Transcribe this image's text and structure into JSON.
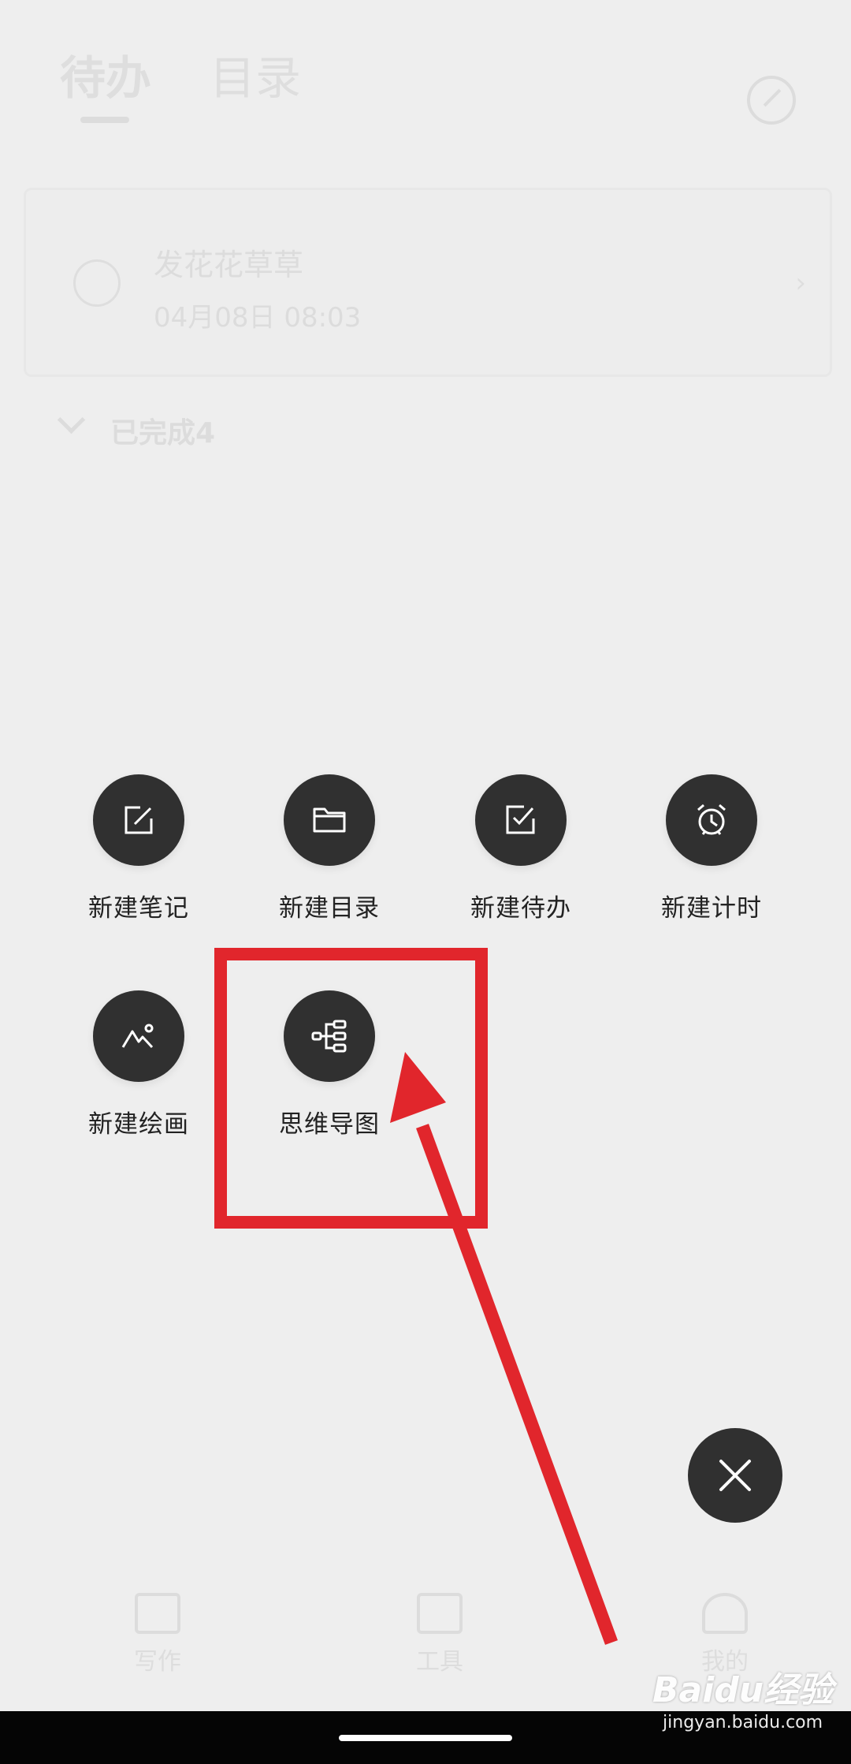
{
  "background_app": {
    "tabs": [
      {
        "label": "待办",
        "active": true
      },
      {
        "label": "目录",
        "active": false
      }
    ],
    "todo_card": {
      "title": "发花花草草",
      "time": "04月08日 08:03"
    },
    "completed_label": "已完成4",
    "bottom_nav": [
      {
        "label": "写作",
        "icon": "home-icon"
      },
      {
        "label": "工具",
        "icon": "toolbox-icon"
      },
      {
        "label": "我的",
        "icon": "person-icon"
      }
    ]
  },
  "create_menu": {
    "items": [
      {
        "label": "新建笔记",
        "icon": "edit-note-icon"
      },
      {
        "label": "新建目录",
        "icon": "folder-icon"
      },
      {
        "label": "新建待办",
        "icon": "checkbox-icon"
      },
      {
        "label": "新建计时",
        "icon": "alarm-clock-icon"
      },
      {
        "label": "新建绘画",
        "icon": "drawing-icon"
      },
      {
        "label": "思维导图",
        "icon": "mind-map-icon"
      }
    ],
    "close_icon": "close-icon"
  },
  "annotation": {
    "color": "#e1262c",
    "target": "思维导图"
  },
  "watermark": {
    "logo": "Baidu经验",
    "url": "jingyan.baidu.com"
  },
  "colors": {
    "overlay_background": "#eeeeee",
    "menu_circle": "#303030",
    "annotation_red": "#e1262c"
  }
}
